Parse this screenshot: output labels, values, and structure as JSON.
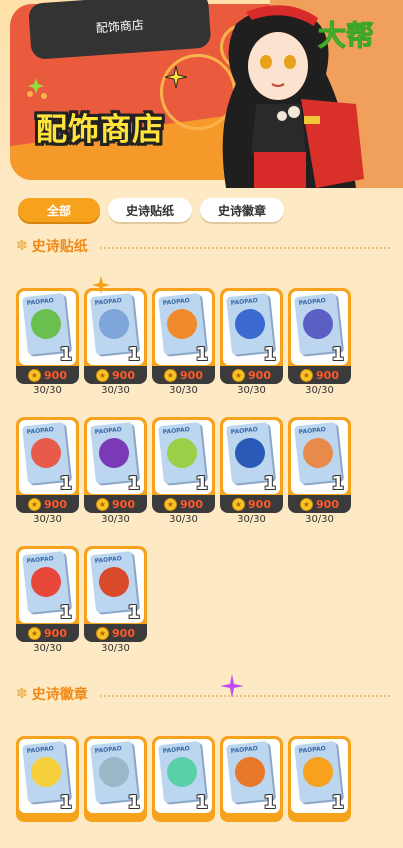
{
  "banner": {
    "label": "配饰商店",
    "title": "配饰商店",
    "corner_text": "大帮"
  },
  "tabs": [
    {
      "label": "全部",
      "active": true
    },
    {
      "label": "史诗贴纸",
      "active": false
    },
    {
      "label": "史诗徽章",
      "active": false
    }
  ],
  "sections": {
    "stickers_title": "史诗贴纸",
    "badges_title": "史诗徽章"
  },
  "colors": {
    "accent": "#f6a21c",
    "price": "#ff5a2a",
    "background": "#fde9c4"
  },
  "sticker_items": [
    {
      "tag": "PAOPAO",
      "qty": "1",
      "price": "900",
      "stock": "30/30",
      "art": "#6bbf4e"
    },
    {
      "tag": "PAOPAO",
      "qty": "1",
      "price": "900",
      "stock": "30/30",
      "art": "#7fa6d8"
    },
    {
      "tag": "PAOPAO",
      "qty": "1",
      "price": "900",
      "stock": "30/30",
      "art": "#f08a2c"
    },
    {
      "tag": "PAOPAO",
      "qty": "1",
      "price": "900",
      "stock": "30/30",
      "art": "#3a6ad0"
    },
    {
      "tag": "PAOPAO",
      "qty": "1",
      "price": "900",
      "stock": "30/30",
      "art": "#5a5fc4"
    },
    {
      "tag": "PAOPAO",
      "qty": "1",
      "price": "900",
      "stock": "30/30",
      "art": "#e85a4a"
    },
    {
      "tag": "PAOPAO",
      "qty": "1",
      "price": "900",
      "stock": "30/30",
      "art": "#7a3ab8"
    },
    {
      "tag": "PAOPAO",
      "qty": "1",
      "price": "900",
      "stock": "30/30",
      "art": "#9ad048"
    },
    {
      "tag": "PAOPAO",
      "qty": "1",
      "price": "900",
      "stock": "30/30",
      "art": "#2a5ab8"
    },
    {
      "tag": "PAOPAO",
      "qty": "1",
      "price": "900",
      "stock": "30/30",
      "art": "#e88a4a"
    },
    {
      "tag": "PAOPAO",
      "qty": "1",
      "price": "900",
      "stock": "30/30",
      "art": "#e8483a"
    },
    {
      "tag": "PAOPAO",
      "qty": "1",
      "price": "900",
      "stock": "30/30",
      "art": "#d84a2a"
    }
  ],
  "badge_items": [
    {
      "tag": "PAOPAO",
      "qty": "1",
      "art": "#f6d03a"
    },
    {
      "tag": "PAOPAO",
      "qty": "1",
      "art": "#9ab8c8"
    },
    {
      "tag": "PAOPAO",
      "qty": "1",
      "art": "#5ad0a8"
    },
    {
      "tag": "PAOPAO",
      "qty": "1",
      "art": "#e8782a"
    },
    {
      "tag": "PAOPAO",
      "qty": "1",
      "art": "#f6a21c"
    }
  ]
}
